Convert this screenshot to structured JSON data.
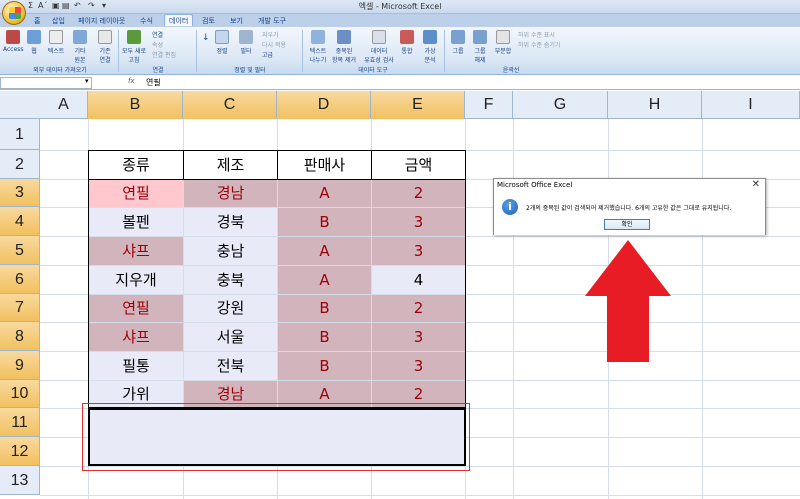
{
  "window": {
    "title": "엑셀 - Microsoft Excel"
  },
  "qat": {
    "sigma": "Σ",
    "font": "Aˊ"
  },
  "tabs": [
    "홈",
    "삽입",
    "페이지 레이아웃",
    "수식",
    "데이터",
    "검토",
    "보기",
    "개발 도구"
  ],
  "active_tab": "데이터",
  "ribbon": {
    "external": {
      "access": "Access",
      "web": "웹",
      "text": "텍스트",
      "other": "기타\n원본",
      "existing": "기존\n연결",
      "group": "외부 데이터 가져오기"
    },
    "connections": {
      "refresh": "모두 새로\n고침",
      "conn": "연결",
      "props": "속성",
      "edit": "연결 편집",
      "group": "연결"
    },
    "sort": {
      "sort_asc": "↓",
      "sort": "정렬",
      "filter": "필터",
      "clear": "지우기",
      "reapply": "다시 적용",
      "advanced": "고급",
      "group": "정렬 및 필터"
    },
    "tools": {
      "text_to_cols": "텍스트\n나누기",
      "remove_dup": "중복된\n항목 제거",
      "validation": "데이터\n유효성 검사",
      "consolidate": "통합",
      "whatif": "가상\n분석",
      "group": "데이터 도구"
    },
    "outline": {
      "group_btn": "그룹",
      "ungroup": "그룹\n해제",
      "subtotal": "부분합",
      "show": "하위 수준 표시",
      "hide": "하위 수준 숨기기",
      "group": "윤곽선"
    }
  },
  "formula_bar": {
    "name_box": "",
    "fx": "fx",
    "value": "연필"
  },
  "columns": [
    "A",
    "B",
    "C",
    "D",
    "E",
    "F",
    "G",
    "H",
    "I"
  ],
  "rows": [
    "1",
    "2",
    "3",
    "4",
    "5",
    "6",
    "7",
    "8",
    "9",
    "10",
    "11",
    "12",
    "13"
  ],
  "table": {
    "headers": [
      "종류",
      "제조",
      "판매사",
      "금액"
    ],
    "rows": [
      [
        "연필",
        "경남",
        "A",
        "2"
      ],
      [
        "볼펜",
        "경북",
        "B",
        "3"
      ],
      [
        "샤프",
        "충남",
        "A",
        "3"
      ],
      [
        "지우개",
        "충북",
        "A",
        "4"
      ],
      [
        "연필",
        "강원",
        "B",
        "2"
      ],
      [
        "샤프",
        "서울",
        "B",
        "3"
      ],
      [
        "필통",
        "전북",
        "B",
        "3"
      ],
      [
        "가위",
        "경남",
        "A",
        "2"
      ]
    ]
  },
  "dialog": {
    "title": "Microsoft Office Excel",
    "close": "✕",
    "message": "2개의 중복된 값이 검색되어 제거했습니다. 6개의 고유한 값은 그대로 유지됩니다.",
    "ok": "확인",
    "icon": "info-icon"
  },
  "colors": {
    "dup_fill": "#d2b4bd",
    "dup_text": "#9c0006",
    "arrow": "#e81c24",
    "outline": "#e03030"
  }
}
